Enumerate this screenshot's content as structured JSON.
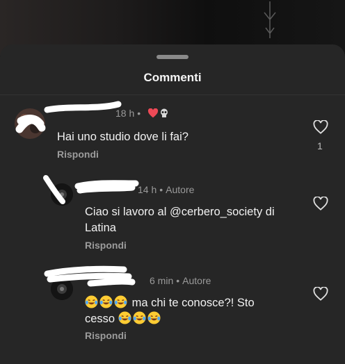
{
  "sheet": {
    "title": "Commenti"
  },
  "comments": [
    {
      "username": "",
      "time": "18 h",
      "author_tag": "",
      "text": "Hai uno studio dove li fai?",
      "reply_label": "Rispondi",
      "like_count": "1",
      "reactions": [
        "red-heart",
        "skull"
      ]
    },
    {
      "username": "",
      "time": "14 h",
      "author_tag": "Autore",
      "text": "Ciao si lavoro al @cerbero_society di Latina",
      "reply_label": "Rispondi",
      "like_count": ""
    },
    {
      "username": "",
      "time": "6 min",
      "author_tag": "Autore",
      "text_part1": "ma chi te conosce?! Sto",
      "text_part2": "cesso",
      "emojis": "laughing-tears",
      "reply_label": "Rispondi",
      "like_count": ""
    }
  ],
  "colors": {
    "sheet": "#262626",
    "text": "#f2f2f2",
    "muted": "#9a9a9a",
    "heart": "#ed4956"
  }
}
